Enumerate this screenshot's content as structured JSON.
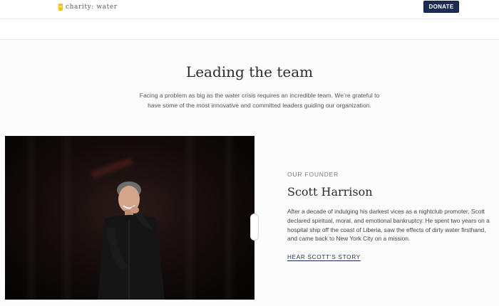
{
  "header": {
    "brand": "charity: water",
    "donate_label": "DONATE"
  },
  "main": {
    "title": "Leading the team",
    "intro": "Facing a problem as big as the water crisis requires an incredible team. We’re grateful to have some of the most innovative and committed leaders guiding our organization."
  },
  "founder": {
    "label": "OUR FOUNDER",
    "name": "Scott Harrison",
    "bio": "After a decade of indulging his darkest vices as a nightclub promoter, Scott declared spiritual, moral, and emotional bankruptcy. He spent two years on a hospital ship off the coast of Liberia, saw the effects of dirty water firsthand, and came back to New York City on a mission.",
    "link_label": "HEAR SCOTT’S STORY"
  },
  "colors": {
    "brand_yellow": "#f2c229",
    "navy": "#1b2c55"
  },
  "icons": {
    "logo": "jerrycan-icon"
  }
}
